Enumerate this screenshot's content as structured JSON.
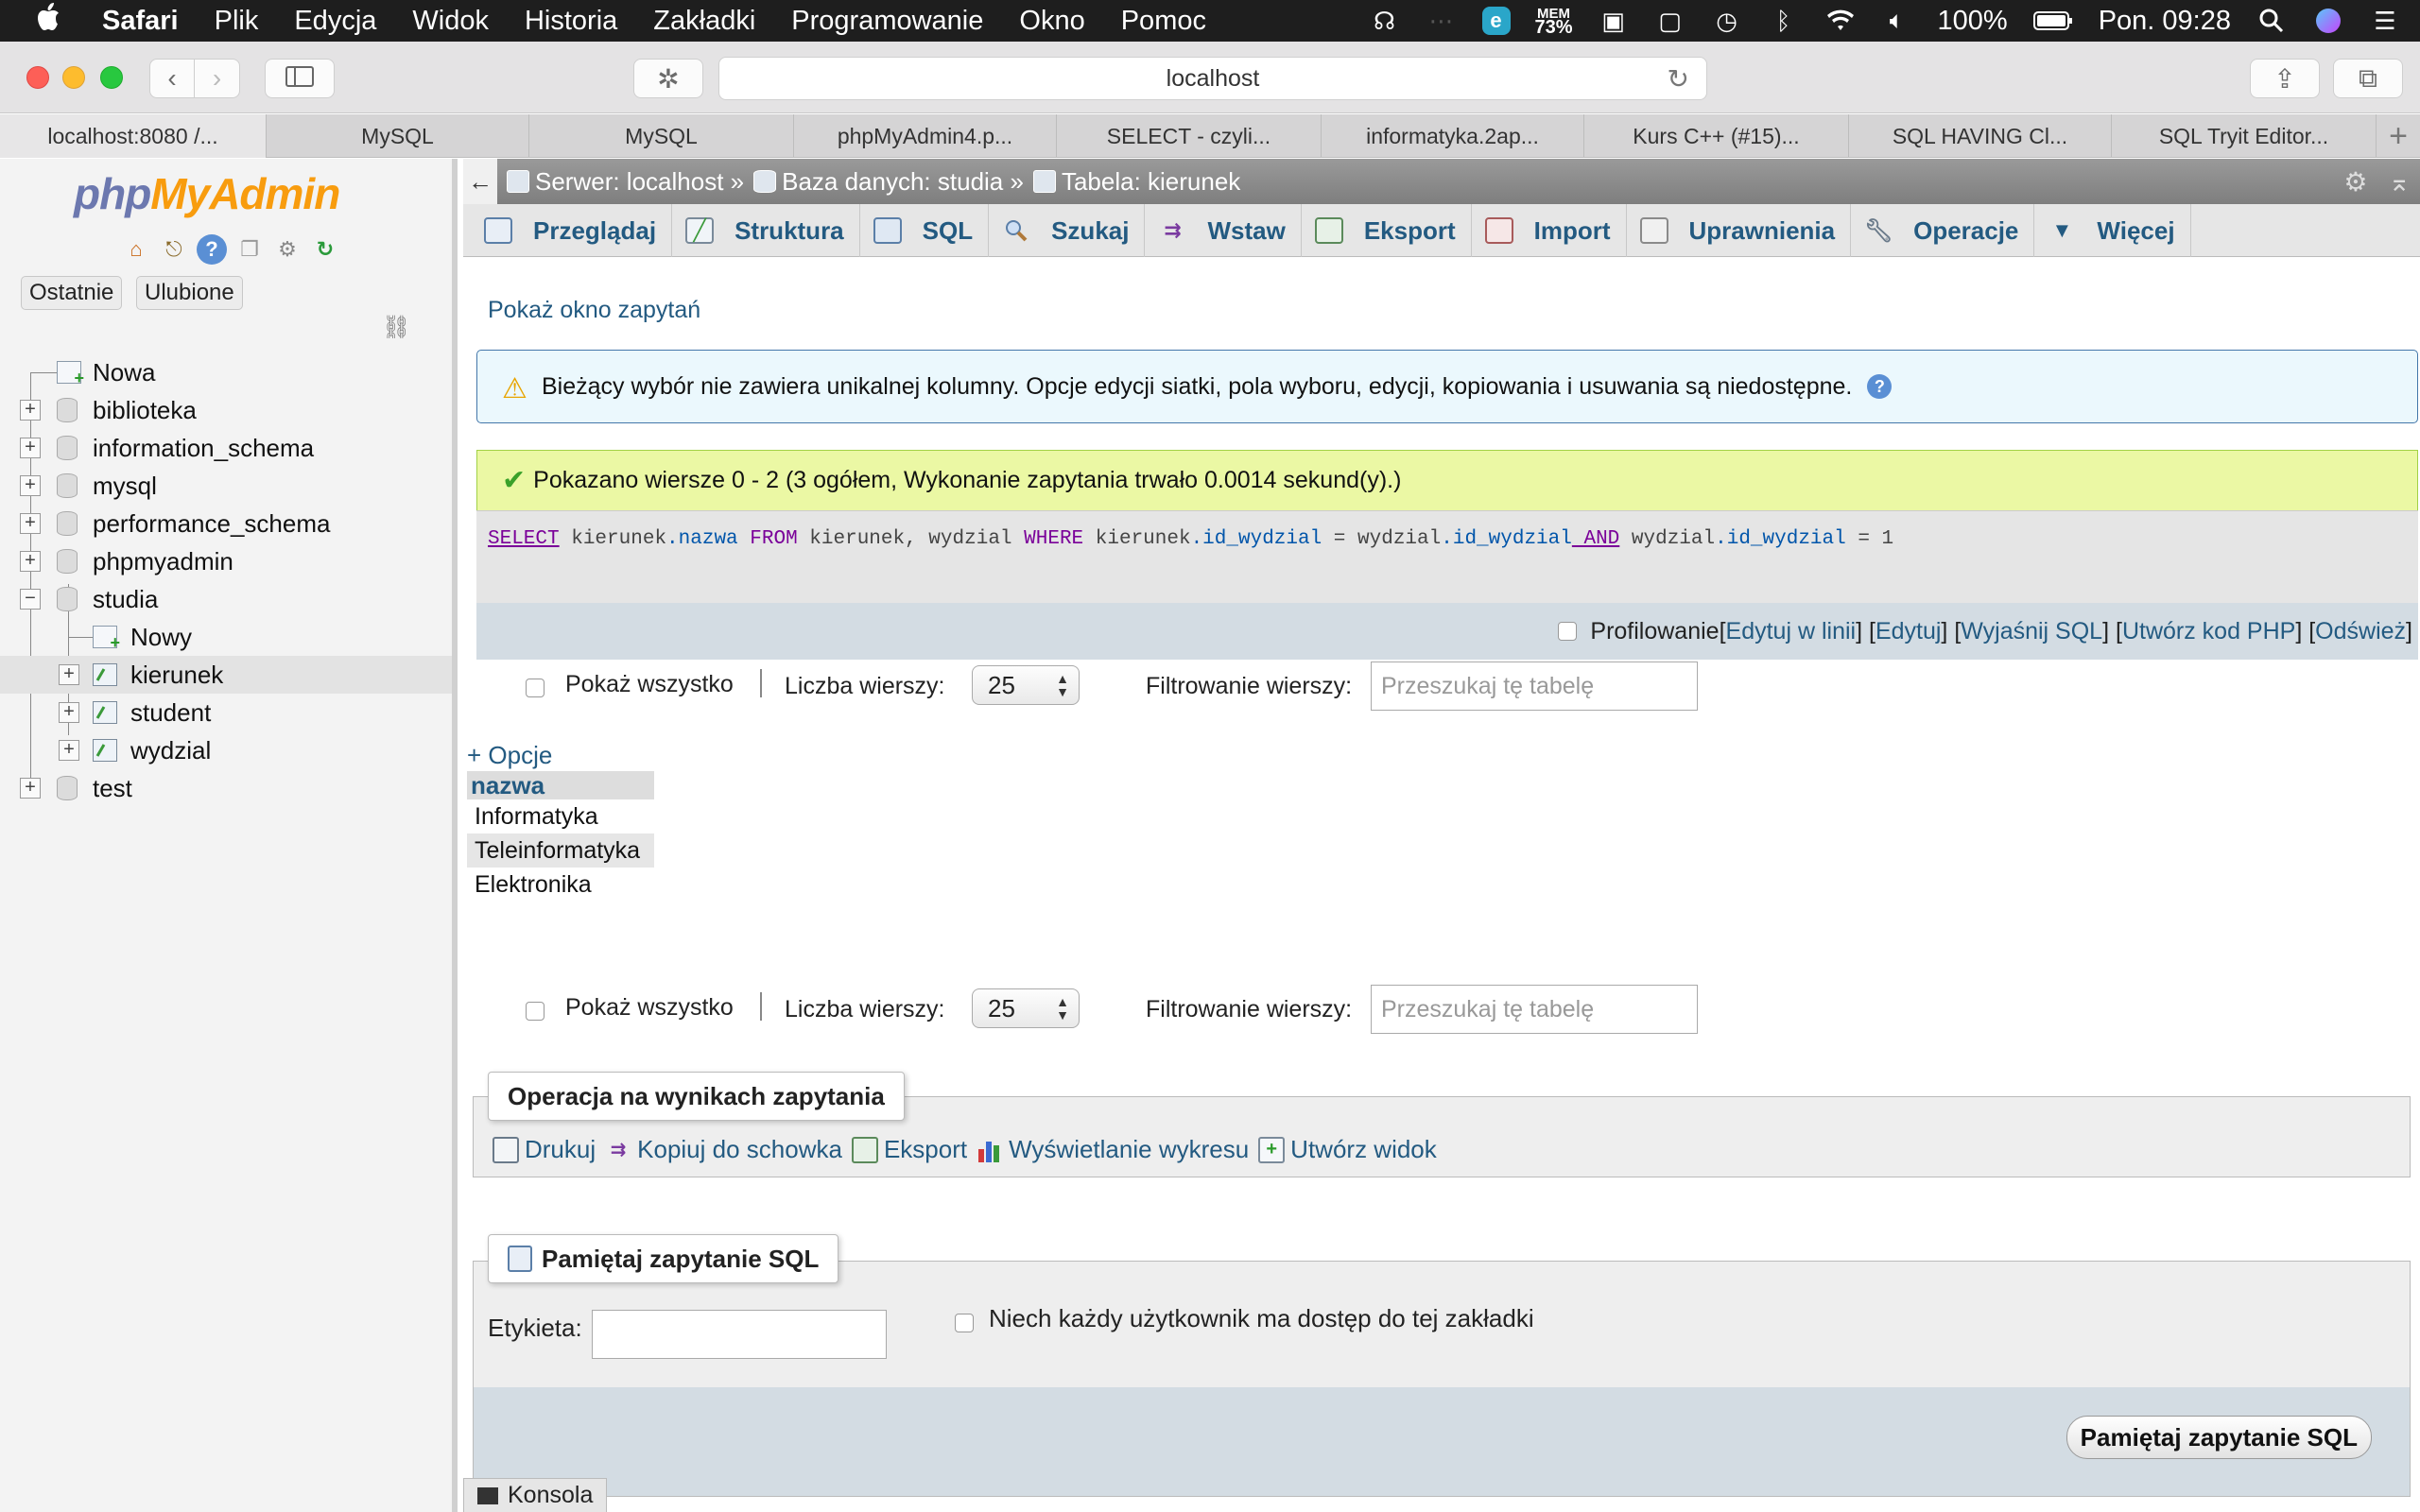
{
  "menubar": {
    "apple": "",
    "app": "Safari",
    "items": [
      "Plik",
      "Edycja",
      "Widok",
      "Historia",
      "Zakładki",
      "Programowanie",
      "Okno",
      "Pomoc"
    ],
    "mem_label": "MEM",
    "mem_value": "73%",
    "battery": "100%",
    "clock": "Pon. 09:28"
  },
  "browser": {
    "url": "localhost",
    "tabs": [
      "localhost:8080 /...",
      "MySQL",
      "MySQL",
      "phpMyAdmin4.p...",
      "SELECT - czyli...",
      "informatyka.2ap...",
      "Kurs C++ (#15)...",
      "SQL HAVING Cl...",
      "SQL Tryit Editor..."
    ],
    "new_tab": "+"
  },
  "sidebar": {
    "logo_php": "php",
    "logo_myadmin": "MyAdmin",
    "btn_recent": "Ostatnie",
    "btn_favorites": "Ulubione",
    "tree": [
      {
        "label": "Nowa"
      },
      {
        "label": "biblioteka"
      },
      {
        "label": "information_schema"
      },
      {
        "label": "mysql"
      },
      {
        "label": "performance_schema"
      },
      {
        "label": "phpmyadmin"
      },
      {
        "label": "studia"
      },
      {
        "label": "Nowy"
      },
      {
        "label": "kierunek"
      },
      {
        "label": "student"
      },
      {
        "label": "wydzial"
      },
      {
        "label": "test"
      }
    ]
  },
  "breadcrumb": {
    "server": "Serwer: localhost »",
    "database": "Baza danych: studia »",
    "table": "Tabela: kierunek"
  },
  "nav_tabs": [
    "Przeglądaj",
    "Struktura",
    "SQL",
    "Szukaj",
    "Wstaw",
    "Eksport",
    "Import",
    "Uprawnienia",
    "Operacje",
    "Więcej"
  ],
  "main": {
    "show_query": "Pokaż okno zapytań",
    "notice": "Bieżący wybór nie zawiera unikalnej kolumny. Opcje edycji siatki, pola wyboru, edycji, kopiowania i usuwania są niedostępne.",
    "success": "Pokazano wiersze 0 - 2 (3 ogółem, Wykonanie zapytania trwało 0.0014 sekund(y).)",
    "sql": {
      "t1": "SELECT",
      "t2": " kierunek",
      "t3": ".nazwa",
      "t4": " FROM",
      "t5": " kierunek, wydzial ",
      "t6": "WHERE",
      "t7": " kierunek",
      "t8": ".id_wydzial",
      "t9": " = wydzial",
      "t10": ".id_wydzial",
      "t11": " AND",
      "t12": " wydzial",
      "t13": ".id_wydzial",
      "t14": " = 1"
    },
    "sql_links": {
      "profiling": "Profilowanie",
      "open1": " [",
      "inline": "Edytuj w linii",
      "sep1": "] [ ",
      "edit": "Edytuj",
      "sep2": " ] [ ",
      "explain": "Wyjaśnij SQL",
      "sep3": " ] [ ",
      "php": "Utwórz kod PHP",
      "sep4": " ] [ ",
      "refresh": "Odśwież",
      "close": "]"
    },
    "nav": {
      "show_all": "Pokaż wszystko",
      "rows_label": "Liczba wierszy:",
      "rows_value": "25",
      "filter_label": "Filtrowanie wierszy:",
      "filter_placeholder": "Przeszukaj tę tabelę"
    },
    "options": "+ Opcje",
    "results": {
      "column": "nazwa",
      "rows": [
        "Informatyka",
        "Teleinformatyka",
        "Elektronika"
      ]
    },
    "query_ops": {
      "legend": "Operacja na wynikach zapytania",
      "print": "Drukuj",
      "copy": "Kopiuj do schowka",
      "export": "Eksport",
      "chart": "Wyświetlanie wykresu",
      "view": "Utwórz widok"
    },
    "bookmark": {
      "legend": "Pamiętaj zapytanie SQL",
      "label": "Etykieta:",
      "shared": "Niech każdy użytkownik ma dostęp do tej zakładki",
      "submit": "Pamiętaj zapytanie SQL"
    },
    "console": "Konsola"
  }
}
